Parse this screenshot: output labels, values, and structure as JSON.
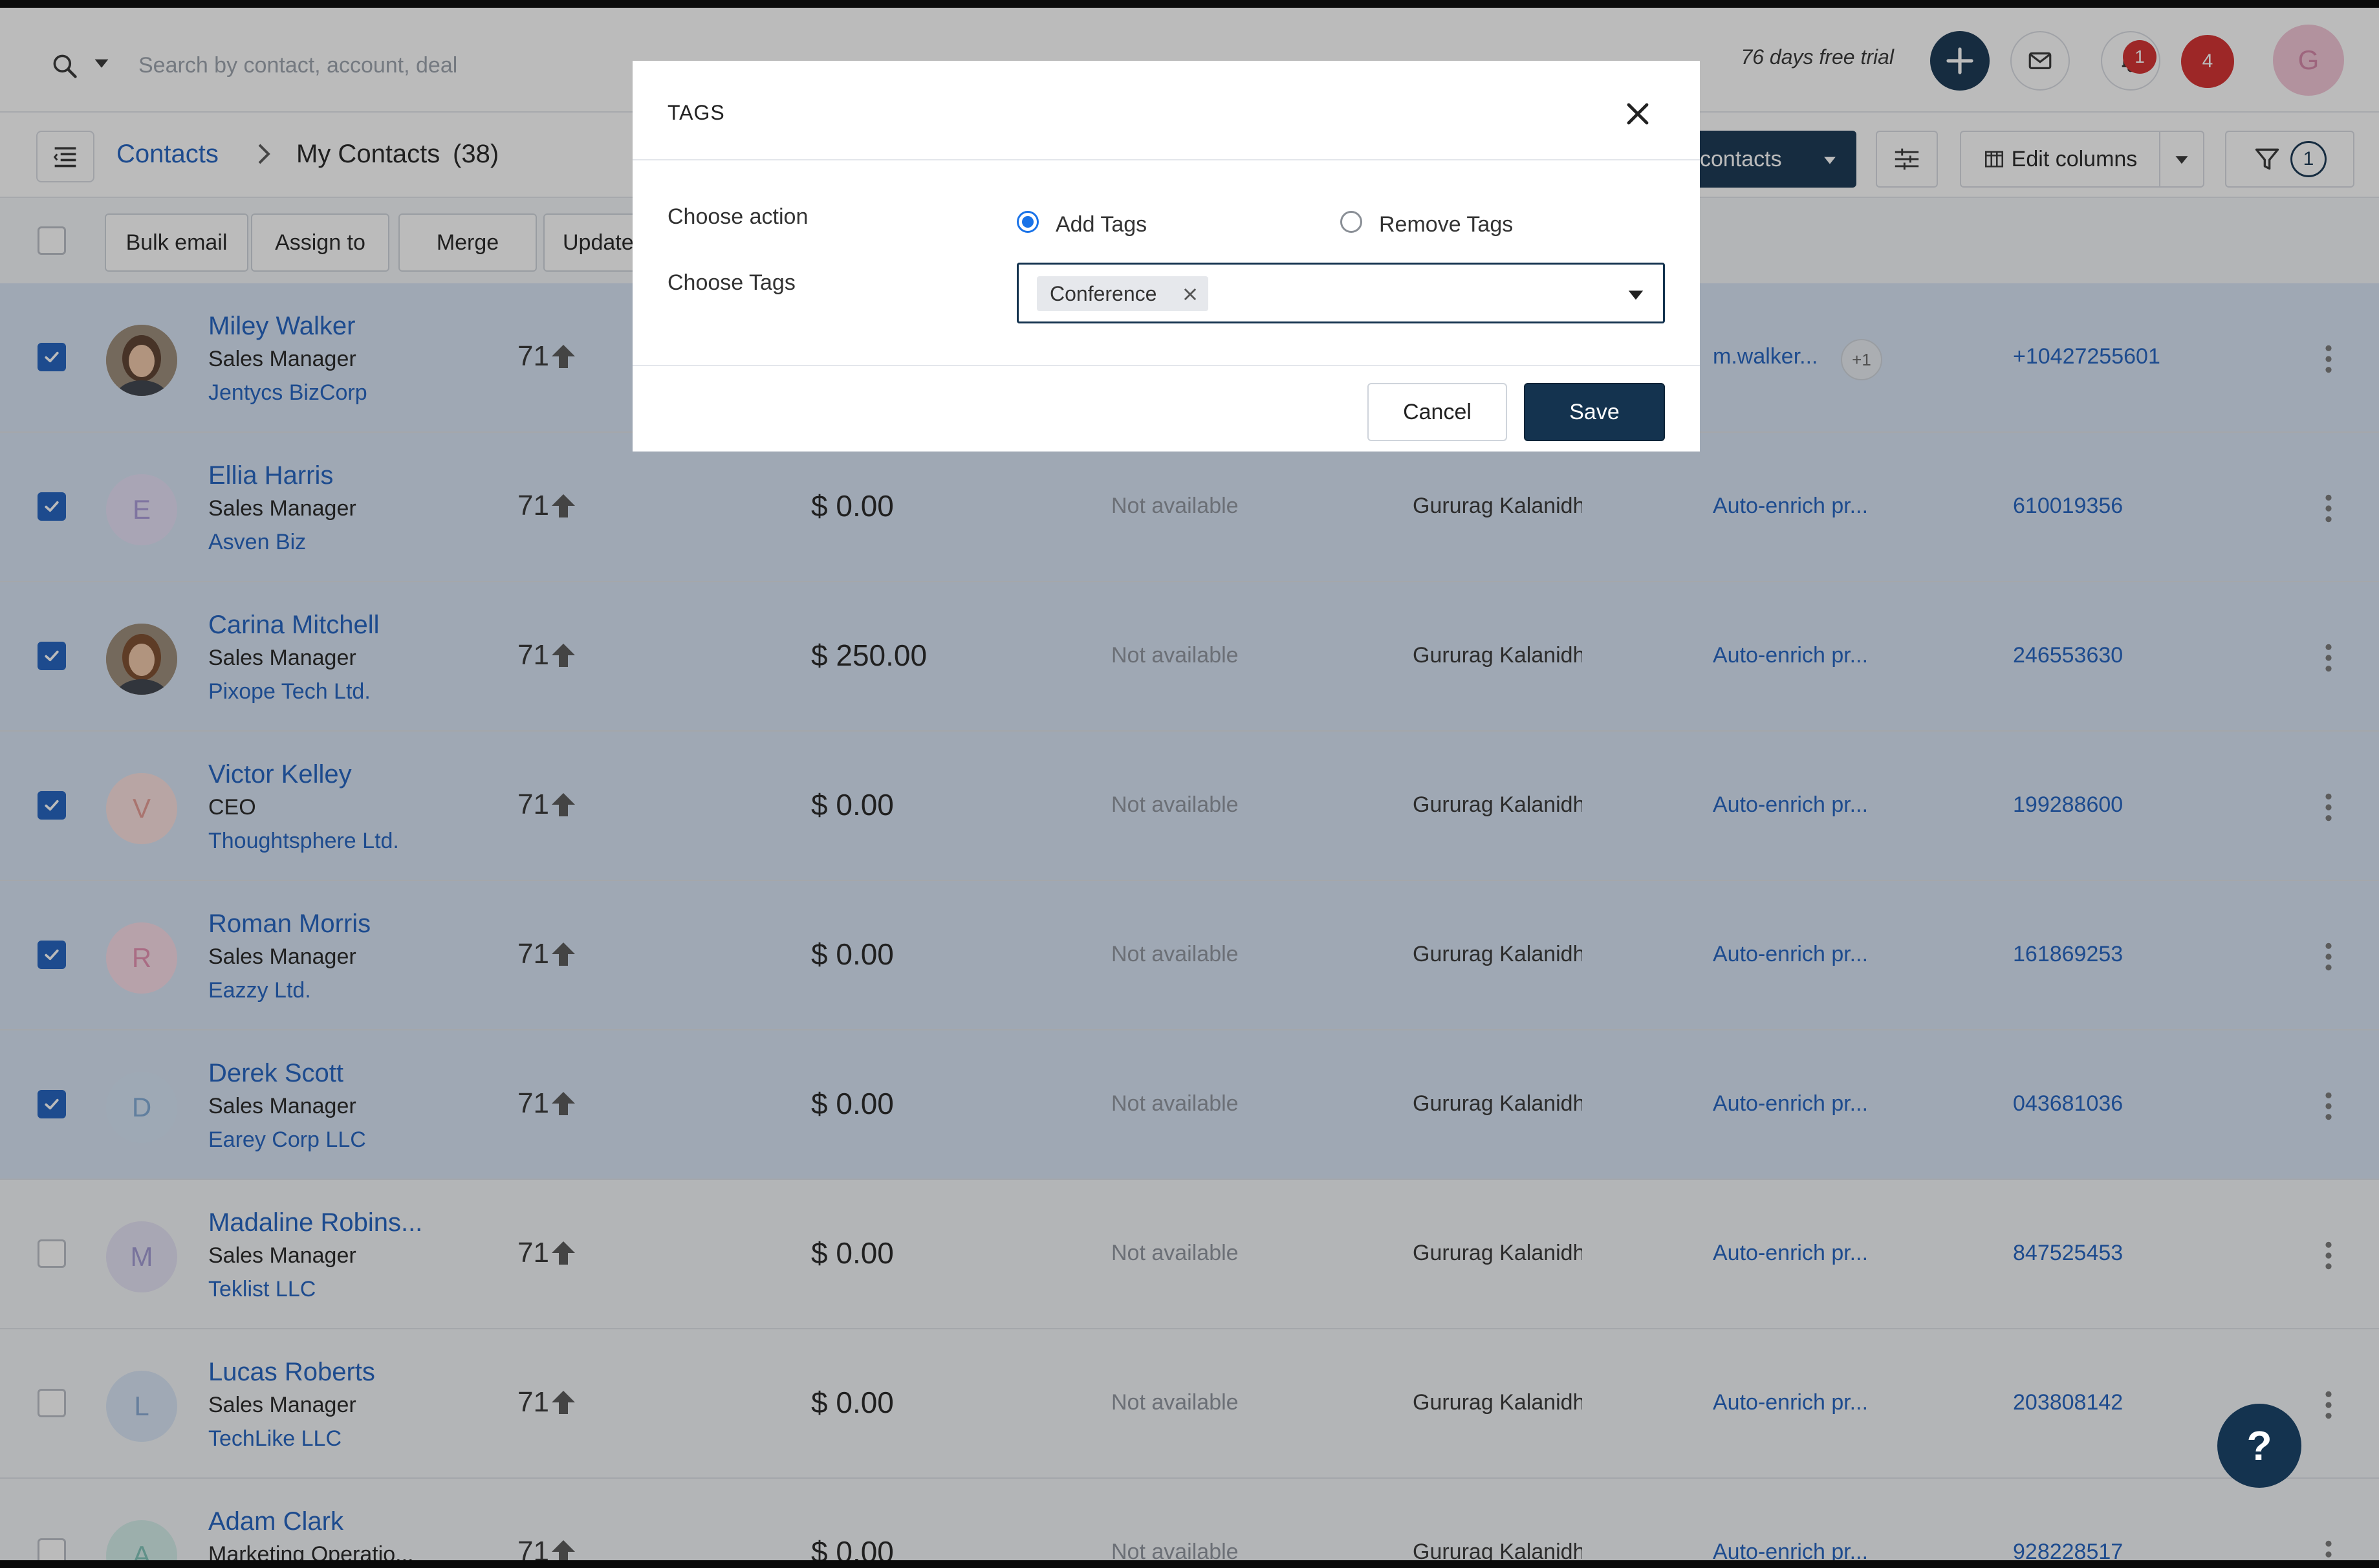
{
  "topbar": {
    "search_placeholder": "Search by contact, account, deal",
    "trial_text": "76 days free trial",
    "notification_badge": "1",
    "alerts_count": "4",
    "user_initial": "G"
  },
  "breadcrumb": {
    "root": "Contacts",
    "current": "My Contacts",
    "count": "(38)"
  },
  "toolbar": {
    "new_contacts_label": "contacts",
    "edit_columns_label": "Edit columns",
    "filter_count": "1"
  },
  "actions": {
    "bulk_email": "Bulk email",
    "assign_to": "Assign to",
    "merge": "Merge",
    "update": "Update"
  },
  "rows": [
    {
      "name": "Miley Walker",
      "title": "Sales Manager",
      "company": "Jentycs BizCorp",
      "score": "71",
      "deal": "",
      "status": "",
      "owner": "",
      "email": "m.walker...",
      "email_extra": "+1",
      "phone": "+10427255601",
      "selected": true,
      "initial": "",
      "avatar_type": "photo"
    },
    {
      "name": "Ellia Harris",
      "title": "Sales Manager",
      "company": "Asven Biz",
      "score": "71",
      "deal": "$ 0.00",
      "status": "Not available",
      "owner": "Gururag Kalanidh",
      "email": "Auto-enrich pr...",
      "email_extra": "",
      "phone": "610019356",
      "selected": true,
      "initial": "E",
      "avatar_type": "initial"
    },
    {
      "name": "Carina Mitchell",
      "title": "Sales Manager",
      "company": "Pixope Tech Ltd.",
      "score": "71",
      "deal": "$ 250.00",
      "status": "Not available",
      "owner": "Gururag Kalanidh",
      "email": "Auto-enrich pr...",
      "email_extra": "",
      "phone": "246553630",
      "selected": true,
      "initial": "",
      "avatar_type": "photo"
    },
    {
      "name": "Victor Kelley",
      "title": "CEO",
      "company": "Thoughtsphere Ltd.",
      "score": "71",
      "deal": "$ 0.00",
      "status": "Not available",
      "owner": "Gururag Kalanidh",
      "email": "Auto-enrich pr...",
      "email_extra": "",
      "phone": "199288600",
      "selected": true,
      "initial": "V",
      "avatar_type": "initial"
    },
    {
      "name": "Roman Morris",
      "title": "Sales Manager",
      "company": "Eazzy Ltd.",
      "score": "71",
      "deal": "$ 0.00",
      "status": "Not available",
      "owner": "Gururag Kalanidh",
      "email": "Auto-enrich pr...",
      "email_extra": "",
      "phone": "161869253",
      "selected": true,
      "initial": "R",
      "avatar_type": "initial"
    },
    {
      "name": "Derek Scott",
      "title": "Sales Manager",
      "company": "Earey Corp LLC",
      "score": "71",
      "deal": "$ 0.00",
      "status": "Not available",
      "owner": "Gururag Kalanidh",
      "email": "Auto-enrich pr...",
      "email_extra": "",
      "phone": "043681036",
      "selected": true,
      "initial": "D",
      "avatar_type": "initial"
    },
    {
      "name": "Madaline Robins...",
      "title": "Sales Manager",
      "company": "Teklist LLC",
      "score": "71",
      "deal": "$ 0.00",
      "status": "Not available",
      "owner": "Gururag Kalanidh",
      "email": "Auto-enrich pr...",
      "email_extra": "",
      "phone": "847525453",
      "selected": false,
      "initial": "M",
      "avatar_type": "initial"
    },
    {
      "name": "Lucas Roberts",
      "title": "Sales Manager",
      "company": "TechLike LLC",
      "score": "71",
      "deal": "$ 0.00",
      "status": "Not available",
      "owner": "Gururag Kalanidh",
      "email": "Auto-enrich pr...",
      "email_extra": "",
      "phone": "203808142",
      "selected": false,
      "initial": "L",
      "avatar_type": "initial"
    },
    {
      "name": "Adam Clark",
      "title": "Marketing Operatio...",
      "company": "",
      "score": "71",
      "deal": "$ 0.00",
      "status": "Not available",
      "owner": "Gururag Kalanidh",
      "email": "Auto-enrich pr...",
      "email_extra": "",
      "phone": "928228517",
      "selected": false,
      "initial": "A",
      "avatar_type": "initial"
    }
  ],
  "modal": {
    "title": "TAGS",
    "choose_action_label": "Choose action",
    "add_tags_label": "Add Tags",
    "remove_tags_label": "Remove Tags",
    "selected_action": "Add Tags",
    "choose_tags_label": "Choose Tags",
    "selected_tag": "Conference",
    "cancel_label": "Cancel",
    "save_label": "Save"
  },
  "help_label": "?",
  "colors": {
    "primary": "#14334f",
    "link": "#1d5fbf",
    "selected_row": "#d7e4f5",
    "badge_red": "#d52b2b"
  }
}
